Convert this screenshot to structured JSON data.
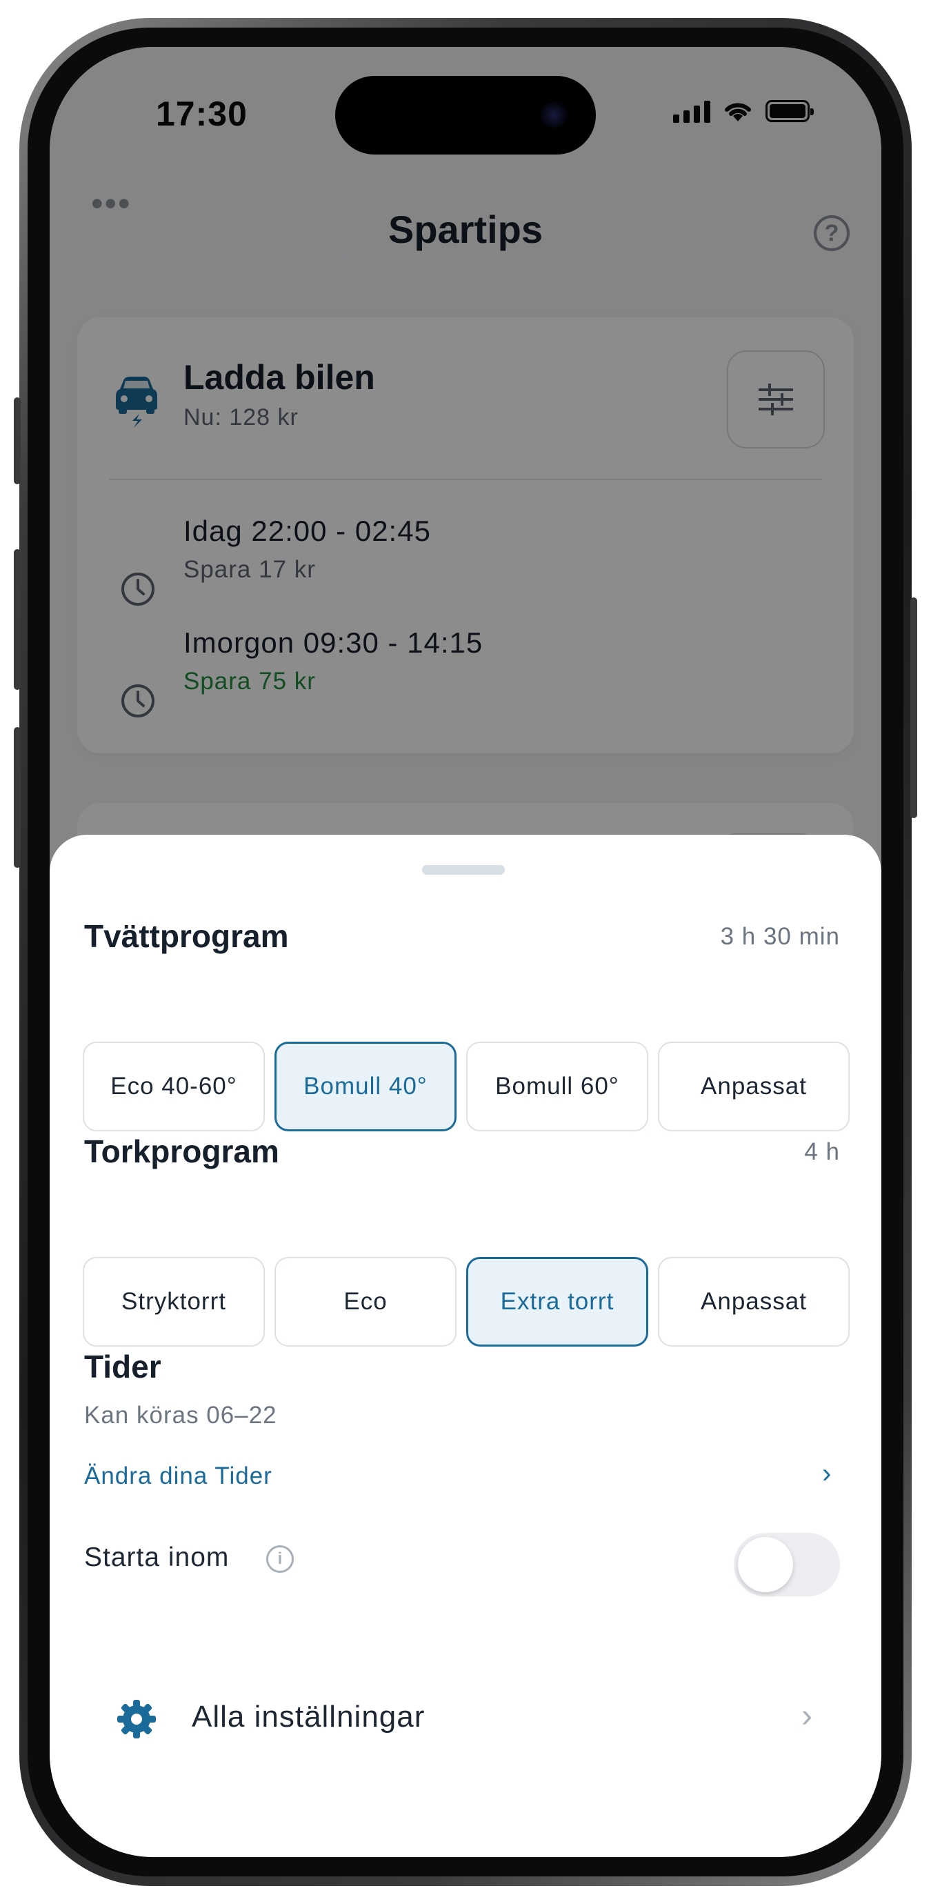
{
  "status_bar": {
    "time": "17:30"
  },
  "nav": {
    "title": "Spartips",
    "more": "•••",
    "help": "?"
  },
  "charge_card": {
    "title": "Ladda bilen",
    "subtitle": "Nu: 128 kr",
    "slots": [
      {
        "time": "Idag 22:00 - 02:45",
        "save": "Spara 17 kr",
        "highlight": false
      },
      {
        "time": "Imorgon 09:30 - 14:15",
        "save": "Spara 75 kr",
        "highlight": true
      }
    ]
  },
  "sheet": {
    "wash": {
      "title": "Tvättprogram",
      "duration": "3 h 30 min",
      "options": [
        {
          "label": "Eco 40-60°",
          "selected": false
        },
        {
          "label": "Bomull 40°",
          "selected": true
        },
        {
          "label": "Bomull 60°",
          "selected": false
        },
        {
          "label": "Anpassat",
          "selected": false
        }
      ]
    },
    "dry": {
      "title": "Torkprogram",
      "duration": "4 h",
      "options": [
        {
          "label": "Stryktorrt",
          "selected": false
        },
        {
          "label": "Eco",
          "selected": false
        },
        {
          "label": "Extra torrt",
          "selected": true
        },
        {
          "label": "Anpassat",
          "selected": false
        }
      ]
    },
    "times": {
      "title": "Tider",
      "subtitle": "Kan köras 06–22",
      "link": "Ändra dina Tider",
      "chevron": "›"
    },
    "start_within": {
      "label": "Starta inom",
      "info": "i",
      "enabled": false
    },
    "all_settings": {
      "label": "Alla inställningar",
      "chevron": "›"
    }
  },
  "colors": {
    "accent": "#1a6b9a",
    "selected_bg": "#e8f2f8",
    "save_green": "#1f8a3e",
    "text_dark": "#16202c",
    "text_muted": "#6b7480"
  }
}
